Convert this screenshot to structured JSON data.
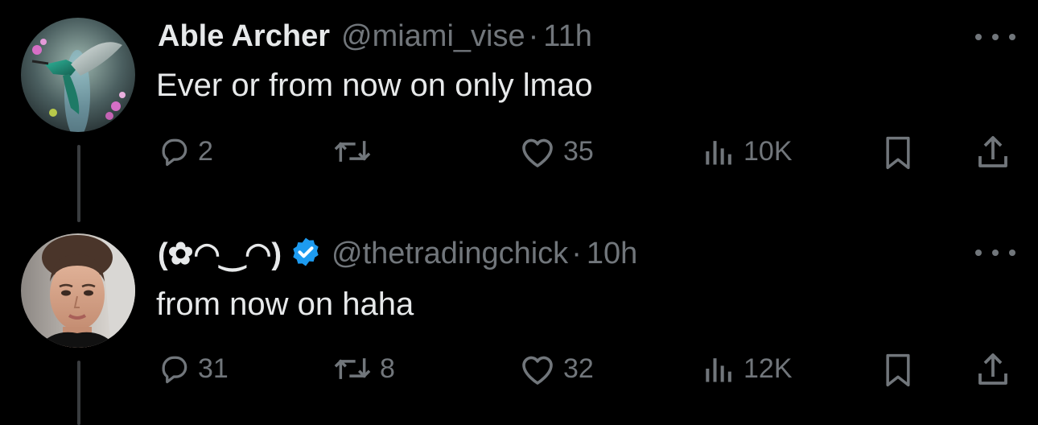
{
  "posts": [
    {
      "name": "Able Archer",
      "handle": "@miami_vise",
      "time": "11h",
      "text": "Ever or from now on only lmao",
      "verified": false,
      "avatar": "hummingbird-avatar",
      "actions": {
        "replies": "2",
        "reposts": "",
        "likes": "35",
        "views": "10K"
      }
    },
    {
      "name": "(✿◠‿◠)",
      "handle": "@thetradingchick",
      "time": "10h",
      "text": "from now on haha",
      "verified": true,
      "avatar": "woman-portrait-avatar",
      "actions": {
        "replies": "31",
        "reposts": "8",
        "likes": "32",
        "views": "12K"
      }
    }
  ],
  "icons": {
    "reply": "reply-icon",
    "repost": "repost-icon",
    "like": "heart-icon",
    "views": "views-icon",
    "bookmark": "bookmark-icon",
    "share": "share-icon",
    "more": "more-icon",
    "verified": "verified-badge-icon"
  },
  "colors": {
    "background": "#000000",
    "text": "#e7e9ea",
    "secondary": "#71767b",
    "verified": "#1d9bf0",
    "thread_line": "#3a3d40"
  }
}
